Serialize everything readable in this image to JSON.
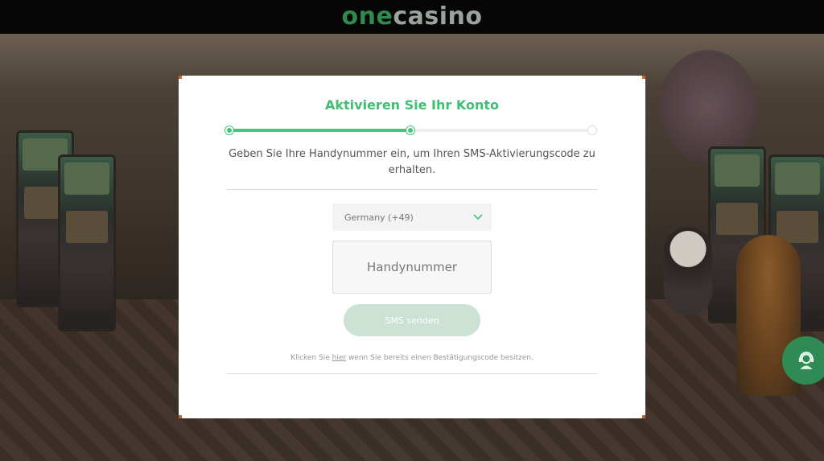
{
  "header": {
    "logo_part1": "one",
    "logo_part2": "casino"
  },
  "modal": {
    "title": "Aktivieren Sie Ihr Konto",
    "progress": {
      "current_step": 2,
      "total_steps": 3
    },
    "instruction": "Geben Sie Ihre Handynummer ein, um Ihren SMS-Aktivierungscode zu erhalten.",
    "country_select": {
      "selected": "Germany (+49)"
    },
    "phone_input": {
      "placeholder": "Handynummer",
      "value": ""
    },
    "send_button": "SMS senden",
    "footer": {
      "prefix": "Klicken Sie ",
      "link": "hier",
      "suffix": " wenn Sie bereits einen Bestätigungscode besitzen."
    }
  },
  "icons": {
    "dropdown": "chevron-down-icon",
    "support": "support-agent-icon"
  },
  "colors": {
    "accent_green": "#3fbf73",
    "progress_green": "#46c47c",
    "button_disabled": "#cbe2d4",
    "header_bg": "#060606",
    "support_bubble": "#2f8a53"
  }
}
